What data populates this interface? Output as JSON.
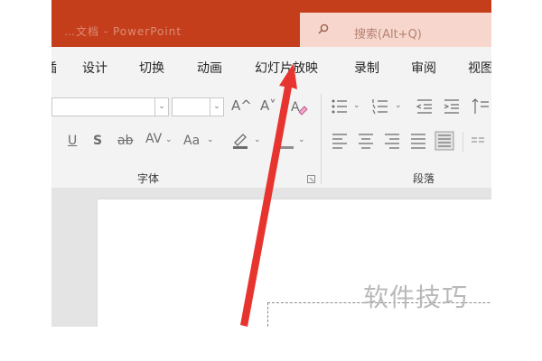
{
  "titlebar": {
    "blurred_title": "…文档 - PowerPoint"
  },
  "search": {
    "text": "搜索(Alt+Q)"
  },
  "ribbon_tabs": [
    {
      "label": "插"
    },
    {
      "label": "设计"
    },
    {
      "label": "切换"
    },
    {
      "label": "动画"
    },
    {
      "label": "幻灯片放映"
    },
    {
      "label": "录制"
    },
    {
      "label": "审阅"
    },
    {
      "label": "视图"
    }
  ],
  "font_group": {
    "label": "字体",
    "grow_font": "A^",
    "shrink_font": "A˅",
    "underline": "U",
    "shadow": "S",
    "strikethrough": "ab",
    "char_spacing": "AV",
    "change_case": "Aa"
  },
  "paragraph_group": {
    "label": "段落"
  },
  "watermark": {
    "text": "软件技巧"
  },
  "colors": {
    "accent": "#c43e1c",
    "arrow": "#e8342f"
  }
}
